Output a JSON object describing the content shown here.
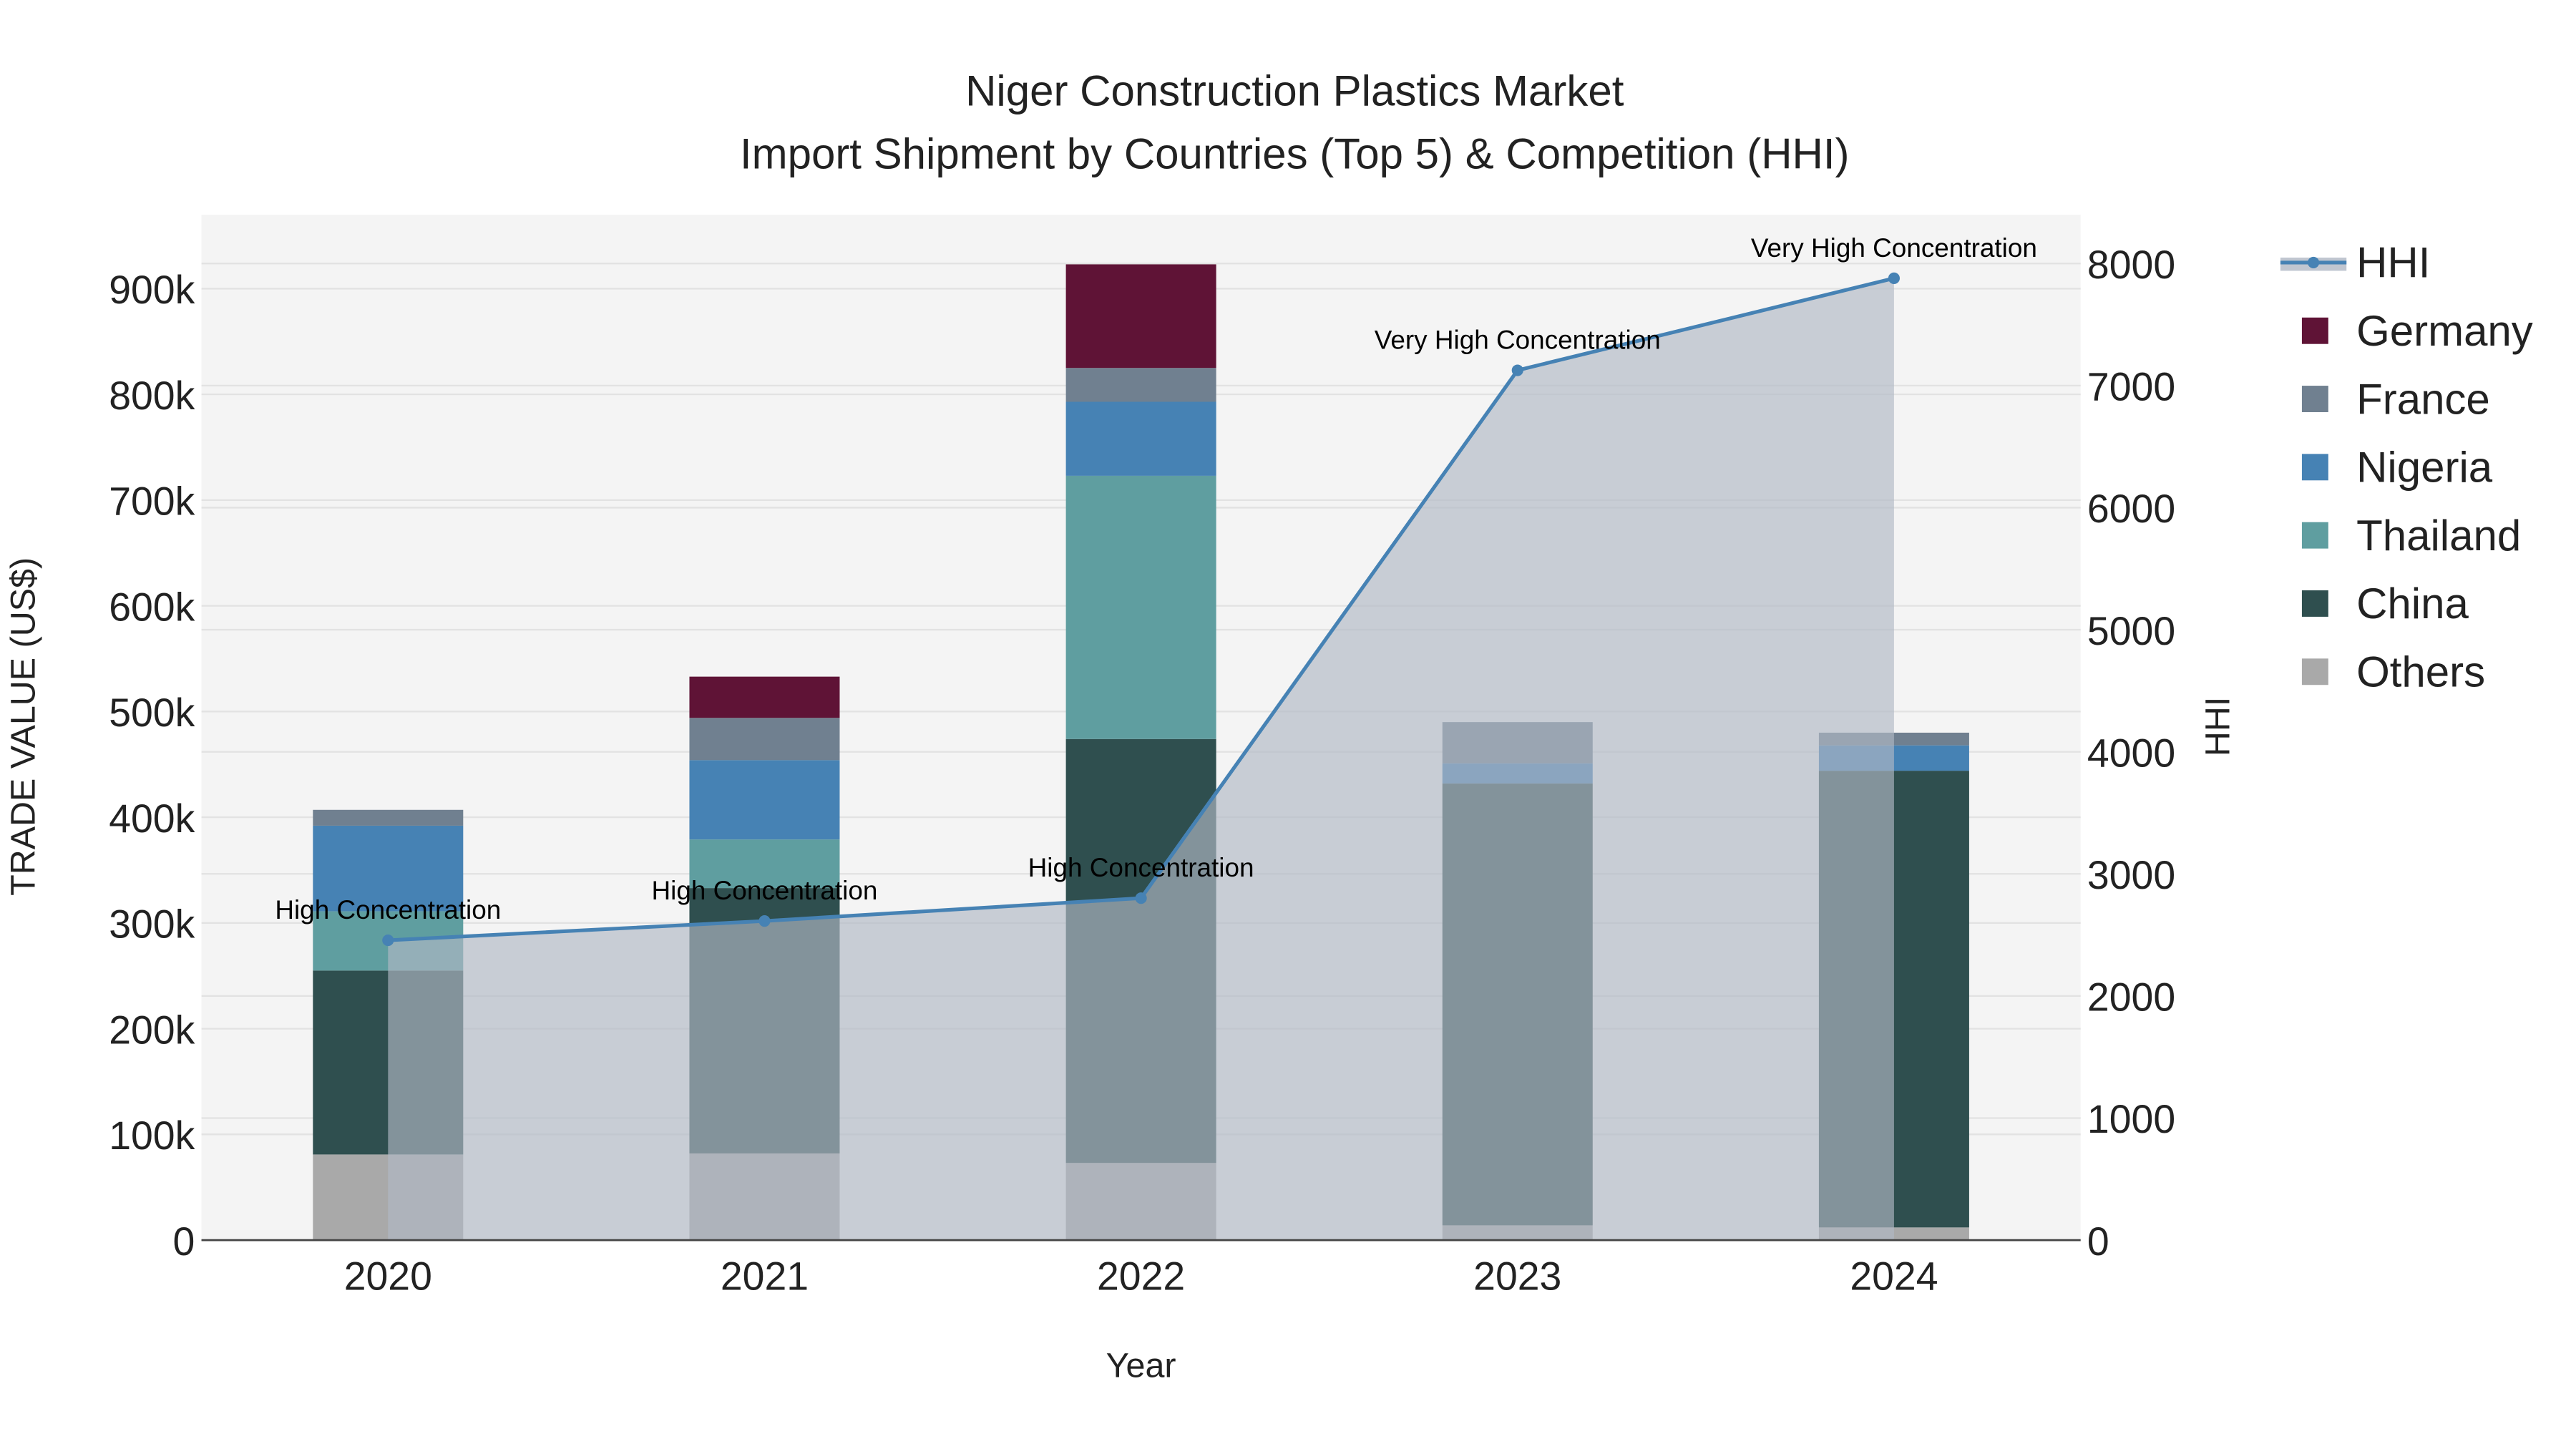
{
  "chart_data": {
    "type": "bar",
    "stacked": true,
    "title": "Niger Construction Plastics Market",
    "subtitle": "Import Shipment by Countries (Top 5) & Competition (HHI)",
    "xlabel": "Year",
    "ylabel": "TRADE VALUE (US$)",
    "y2label": "HHI",
    "categories": [
      "2020",
      "2021",
      "2022",
      "2023",
      "2024"
    ],
    "ylim": [
      0,
      970000
    ],
    "y2lim": [
      0,
      8400
    ],
    "yticks": [
      0,
      100000,
      200000,
      300000,
      400000,
      500000,
      600000,
      700000,
      800000,
      900000
    ],
    "ytick_labels": [
      "0",
      "100k",
      "200k",
      "300k",
      "400k",
      "500k",
      "600k",
      "700k",
      "800k",
      "900k"
    ],
    "y2ticks": [
      0,
      1000,
      2000,
      3000,
      4000,
      5000,
      6000,
      7000,
      8000
    ],
    "y2tick_labels": [
      "0",
      "1000",
      "2000",
      "3000",
      "4000",
      "5000",
      "6000",
      "7000",
      "8000"
    ],
    "grid": true,
    "legend_position": "right",
    "series": [
      {
        "name": "Others",
        "color": "#a9a9a9",
        "values": [
          81000,
          82000,
          73000,
          14000,
          12000
        ]
      },
      {
        "name": "China",
        "color": "#2f4f4f",
        "values": [
          174000,
          251000,
          401000,
          418000,
          432000
        ]
      },
      {
        "name": "Thailand",
        "color": "#5f9ea0",
        "values": [
          56000,
          46000,
          249000,
          0,
          0
        ]
      },
      {
        "name": "Nigeria",
        "color": "#4682b4",
        "values": [
          81000,
          75000,
          70000,
          19000,
          24000
        ]
      },
      {
        "name": "France",
        "color": "#708090",
        "values": [
          15000,
          40000,
          32000,
          39000,
          12000
        ]
      },
      {
        "name": "Germany",
        "color": "#5f1336",
        "values": [
          0,
          39000,
          98000,
          0,
          0
        ]
      }
    ],
    "hhi": {
      "name": "HHI",
      "color": "#4682b4",
      "fill": "#b0b8c4",
      "values": [
        2456,
        2614,
        2801,
        7125,
        7879
      ],
      "annotations": [
        "High Concentration",
        "High Concentration",
        "High Concentration",
        "Very High Concentration",
        "Very High Concentration"
      ]
    },
    "legend_order": [
      "HHI",
      "Germany",
      "France",
      "Nigeria",
      "Thailand",
      "China",
      "Others"
    ]
  }
}
